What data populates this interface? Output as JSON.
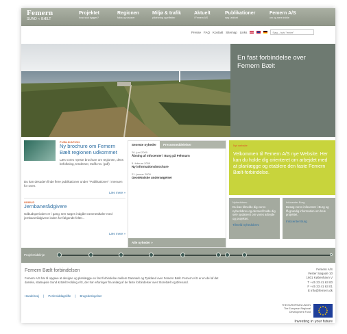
{
  "nav": {
    "logo_line1": "Femern",
    "logo_line2": "SUND ≈ BÆLT",
    "items": [
      {
        "title": "Projektet",
        "sub": "hvad skal bygges?"
      },
      {
        "title": "Regionen",
        "sub": "fakta og visioner"
      },
      {
        "title": "Miljø & trafik",
        "sub": "påvirkning og effekter"
      },
      {
        "title": "Aktuelt",
        "sub": "i Femern A/S"
      },
      {
        "title": "Publikationer",
        "sub": "søg i arkivet"
      },
      {
        "title": "Femern A/S",
        "sub": "om og mere indsle"
      }
    ]
  },
  "util": {
    "links": [
      "Presse",
      "FAQ",
      "Kontakt",
      "Sitemap",
      "Links"
    ],
    "search_placeholder": "Søg – tryk \"enter\"",
    "flag_colors": [
      "#c8102e",
      "#c8102e",
      "#000000"
    ]
  },
  "hero": {
    "title": "En fast forbindelse over Femern Bælt"
  },
  "publication": {
    "category": "PUBLIKATION",
    "title": "Ny brochure om Femern Bælt regionen udkommet",
    "teaser": "Læs vores nyeste brochure om regionen, dens befolkning, tenderser, trafik mv. (pdf)",
    "body": "Du kan desuden finde flere publikationer under \"Publikationer\" i menuen for oven.",
    "more": "Læs mere »"
  },
  "udbud": {
    "category": "UDBUD",
    "title": "Jernbanerådgivere",
    "text": "Udbudsperioden er i gang. Der søges indgået rammeaftaler med jernbanerådgivere inden for følgende felter...",
    "more": "Læs mere »"
  },
  "news": {
    "tab_active": "Seneste nyheder",
    "tab_inactive": "Pressemeddelelser",
    "items": [
      {
        "date": "26. juni 2009",
        "headline": "Åbning af Infocenter i Burg på Fehmarn"
      },
      {
        "date": "5. februar 2009",
        "headline": "Ny informationsbrochure"
      },
      {
        "date": "21. januar 2009",
        "headline": "Geotekniske undersøgelser"
      }
    ],
    "all_link": "Alle nyheder »"
  },
  "welcome": {
    "label": "Nyt website",
    "text": "Velkommen til Femern A/S nye Website. Her kan du holde dig orienteret om arbejdet med at planlægge og etablere den faste Femern Bælt-forbindelse."
  },
  "newsletter": {
    "label": "Nyhedsbrev",
    "text": "Du kan tilmelde dig vores nyhedsbrev og dermed holde dig selv opdateret om vores arbejde og projektet.",
    "link": "Tilmeld nyhedsbrev"
  },
  "infocenter": {
    "label": "Infocenter Burg",
    "text": "Besøg vores infocenter i Burg og få grundig information om hele projektet.",
    "link": "Infocenter Burg"
  },
  "timeline": {
    "label": "Projekt tidslinje"
  },
  "footer": {
    "title": "Femern Bælt forbindelsen",
    "text": "Femern A/S har til opgave at designe og planlægge en fast forbindelse mellem Danmark og Tyskland over Femern Bælt. Femern A/S er en del af det danske, statsejede Sund & Bælt Holding A/S, der har erfaringer fra anlæg af de faste forbindelser over Storebælt og Øresund.",
    "links": [
      "Handelsvej",
      "Perlemiddagslifte",
      "Brugsbetingelser"
    ],
    "address": [
      "Femern A/S",
      "Vester Søgade 10",
      "1601 København V",
      "T +45 33 41 63 00",
      "F +45 33 41 63 01",
      "E info@femern.dk"
    ],
    "eu_lines": [
      "THE EUROPEAN UNION",
      "The European Regional",
      "Development Fund"
    ],
    "invest": "Investing in your future"
  }
}
